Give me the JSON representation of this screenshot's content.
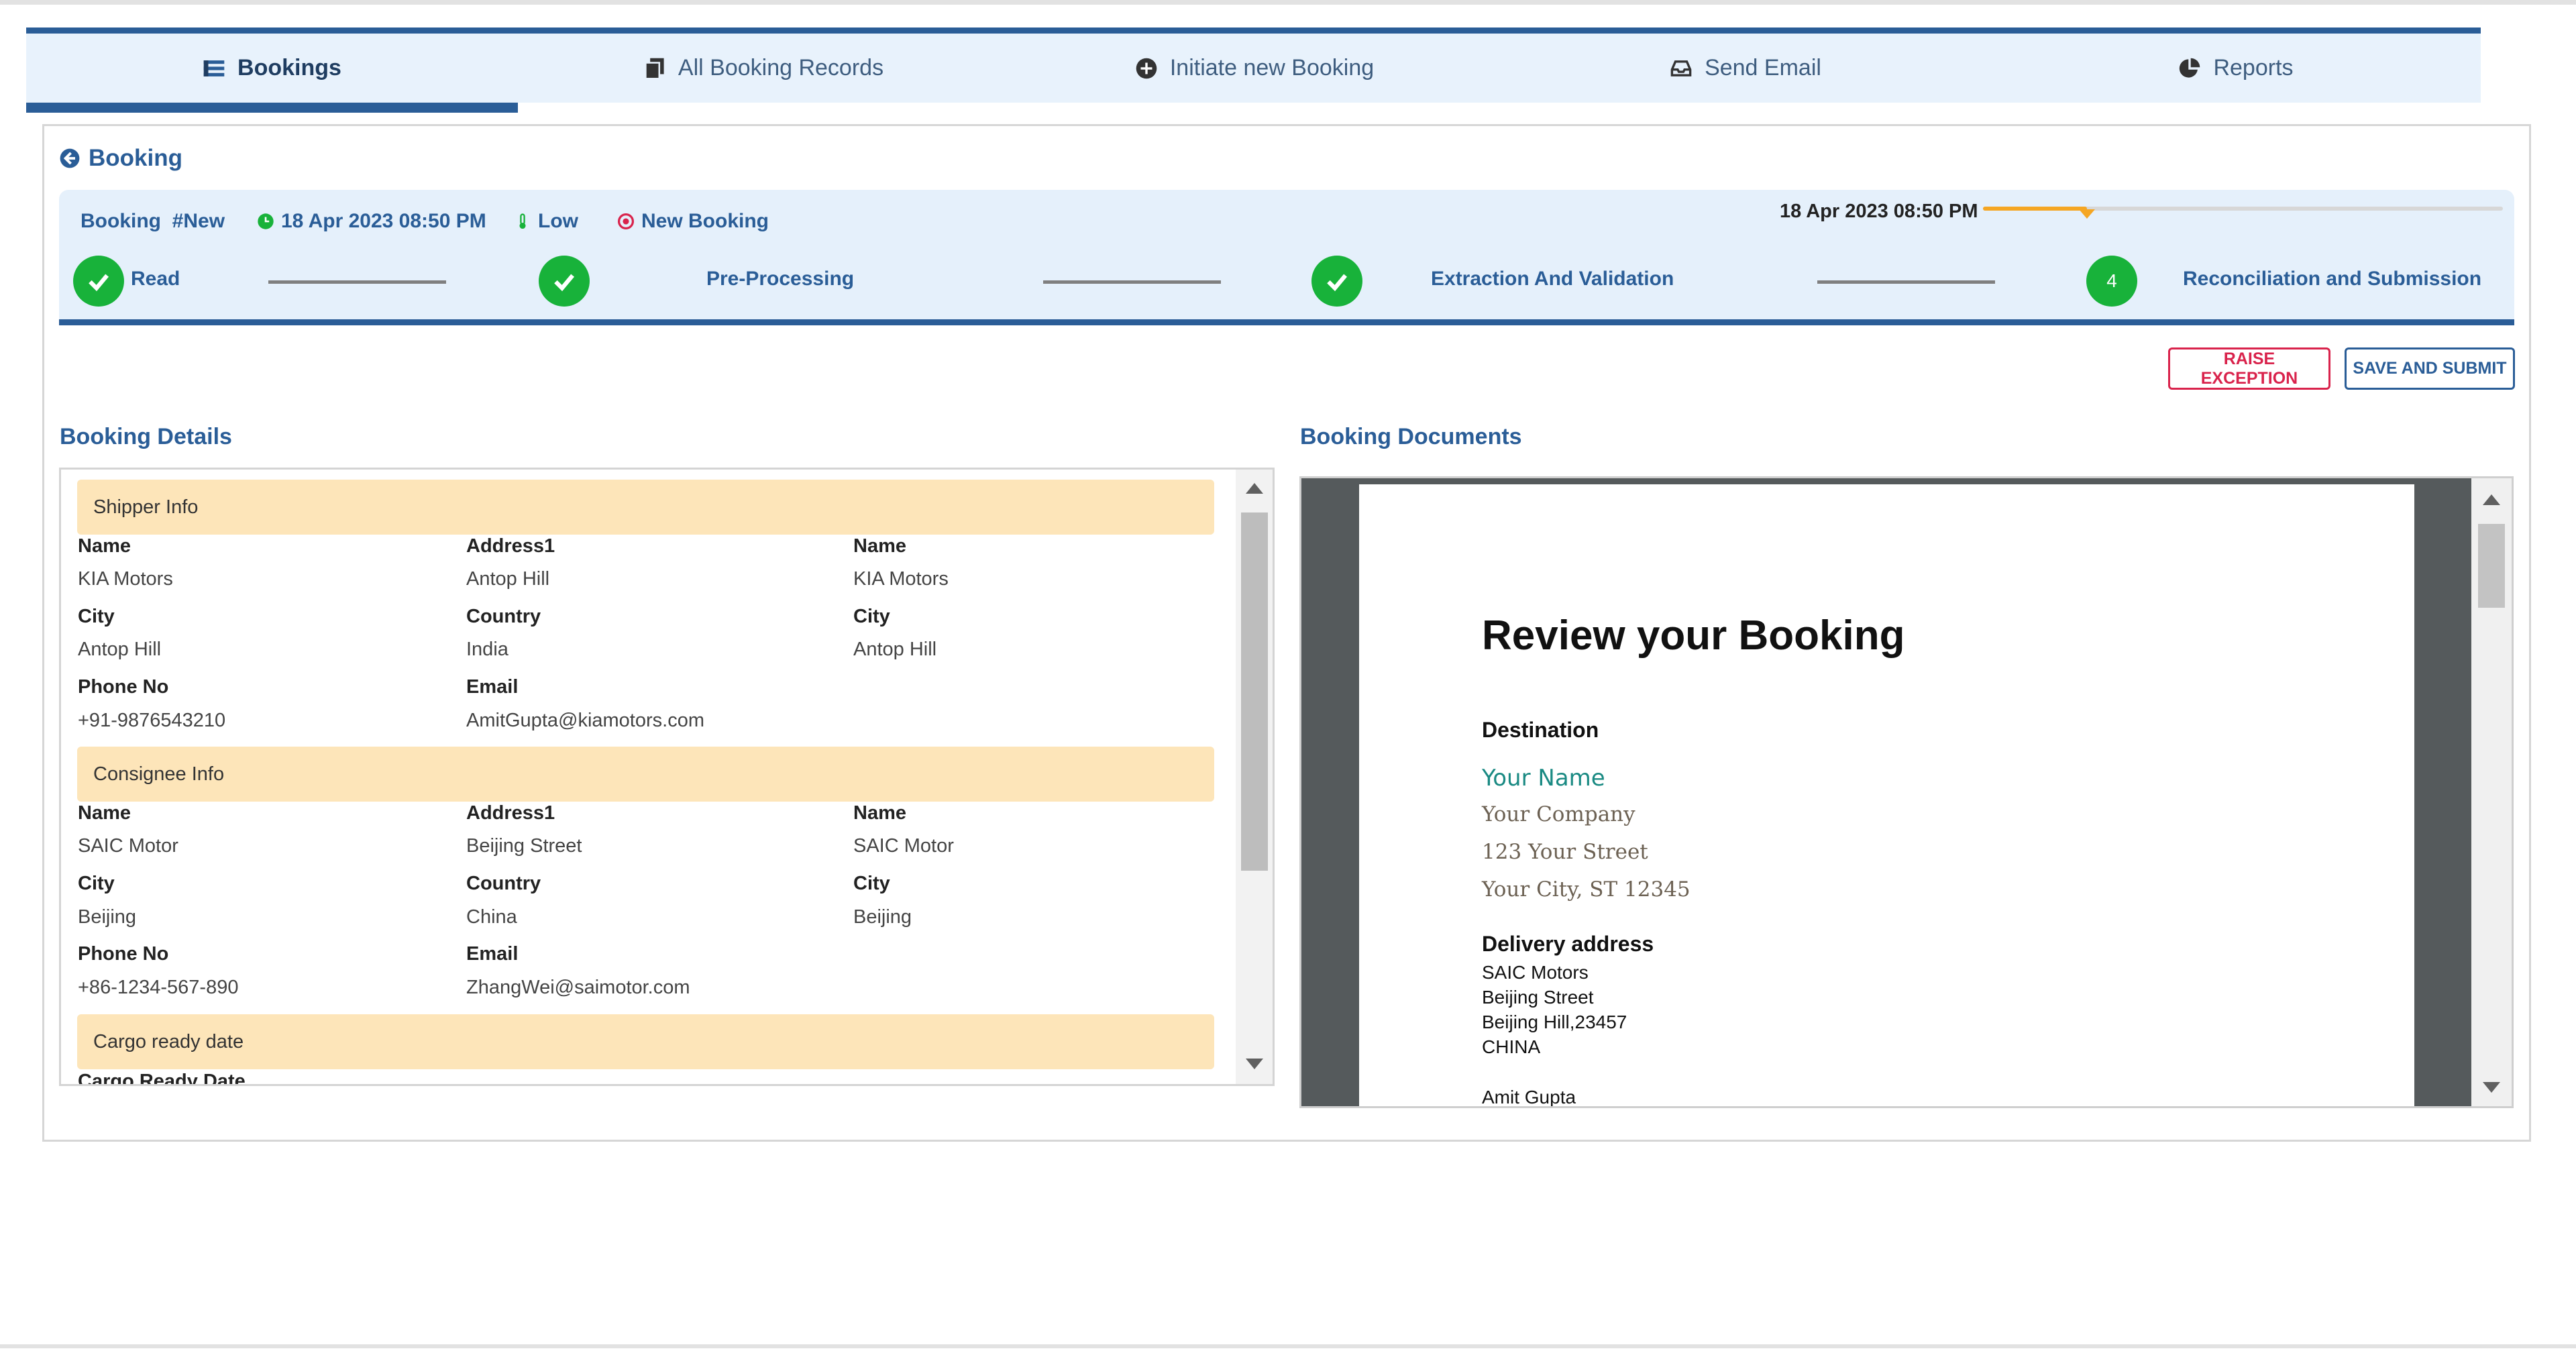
{
  "tabs": [
    {
      "label": "Bookings",
      "icon": "list-icon",
      "active": true
    },
    {
      "label": "All Booking Records",
      "icon": "copy-icon",
      "active": false
    },
    {
      "label": "Initiate new Booking",
      "icon": "plus-circle-icon",
      "active": false
    },
    {
      "label": "Send Email",
      "icon": "inbox-icon",
      "active": false
    },
    {
      "label": "Reports",
      "icon": "pie-chart-icon",
      "active": false
    }
  ],
  "back_label": "Booking",
  "status": {
    "booking_id": "Booking  #New",
    "timestamp": "18 Apr 2023 08:50 PM",
    "priority": "Low",
    "state": "New Booking",
    "right_timestamp": "18 Apr 2023 08:50 PM",
    "progress_percent": 20
  },
  "steps": [
    {
      "label": "Read",
      "done": true
    },
    {
      "label": "Pre-Processing",
      "done": true
    },
    {
      "label": "Extraction And Validation",
      "done": true
    },
    {
      "label": "Reconciliation and Submission",
      "number": "4",
      "done": false
    }
  ],
  "actions": {
    "raise_exception": "RAISE EXCEPTION",
    "save_submit": "SAVE AND SUBMIT"
  },
  "details": {
    "title": "Booking Details",
    "shipper": {
      "header": "Shipper Info",
      "name_label": "Name",
      "name": "KIA Motors",
      "address_label": "Address1",
      "address": "Antop Hill",
      "name2_label": "Name",
      "name2": "KIA Motors",
      "city_label": "City",
      "city": "Antop Hill",
      "country_label": "Country",
      "country": "India",
      "city2_label": "City",
      "city2": "Antop Hill",
      "phone_label": "Phone No",
      "phone": "+91-9876543210",
      "email_label": "Email",
      "email": "AmitGupta@kiamotors.com"
    },
    "consignee": {
      "header": "Consignee Info",
      "name_label": "Name",
      "name": "SAIC Motor",
      "address_label": "Address1",
      "address": "Beijing Street",
      "name2_label": "Name",
      "name2": "SAIC Motor",
      "city_label": "City",
      "city": "Beijing",
      "country_label": "Country",
      "country": "China",
      "city2_label": "City",
      "city2": "Beijing",
      "phone_label": "Phone No",
      "phone": "+86-1234-567-890",
      "email_label": "Email",
      "email": "ZhangWei@saimotor.com"
    },
    "cargo": {
      "header": "Cargo ready date",
      "label": "Cargo Ready Date"
    }
  },
  "documents": {
    "title": "Booking Documents",
    "doc_title": "Review your Booking",
    "destination_label": "Destination",
    "your_name": "Your Name",
    "your_company": "Your Company",
    "your_street": "123 Your Street",
    "your_city": "Your City, ST 12345",
    "delivery_label": "Delivery address",
    "delivery_lines": [
      "SAIC Motors",
      "Beijing Street",
      "Beijing Hill,23457",
      "CHINA"
    ],
    "signoff": "Amit Gupta"
  },
  "colors": {
    "accent": "#2a5d97",
    "success": "#18b23a",
    "danger": "#d9234c",
    "progress": "#f5a623",
    "group_header": "#fde5b9"
  }
}
